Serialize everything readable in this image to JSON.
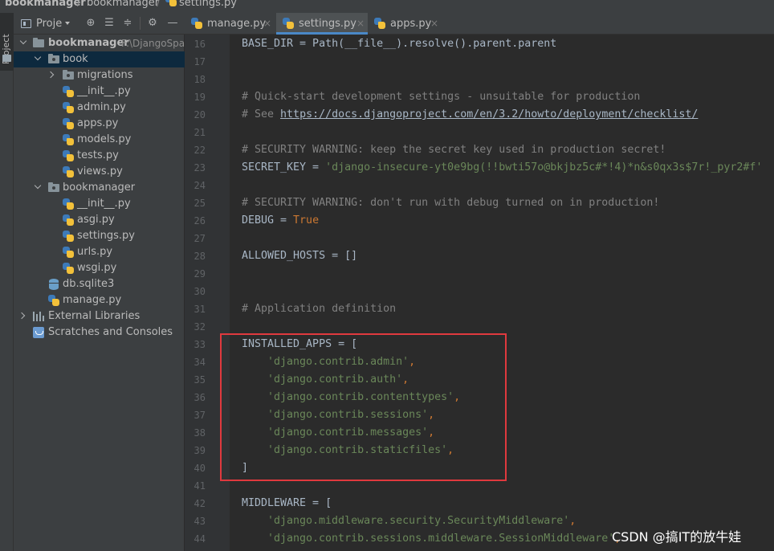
{
  "breadcrumb": {
    "items": [
      "bookmanager",
      "bookmanager",
      "settings.py"
    ],
    "separator": "/"
  },
  "tool_strip": {
    "project_label": "Project"
  },
  "project_panel": {
    "title": "Proje",
    "tree": [
      {
        "label": "bookmanager",
        "path": "F:\\DjangoSpa",
        "icon": "folder-icon",
        "expanded": true
      },
      {
        "label": "book",
        "icon": "folder-icon",
        "expanded": true,
        "selected": true
      },
      {
        "label": "migrations",
        "icon": "folder-icon",
        "expanded": false
      },
      {
        "label": "__init__.py",
        "icon": "python-file-icon"
      },
      {
        "label": "admin.py",
        "icon": "python-file-icon"
      },
      {
        "label": "apps.py",
        "icon": "python-file-icon"
      },
      {
        "label": "models.py",
        "icon": "python-file-icon"
      },
      {
        "label": "tests.py",
        "icon": "python-file-icon"
      },
      {
        "label": "views.py",
        "icon": "python-file-icon"
      },
      {
        "label": "bookmanager",
        "icon": "folder-icon",
        "expanded": true
      },
      {
        "label": "__init__.py",
        "icon": "python-file-icon"
      },
      {
        "label": "asgi.py",
        "icon": "python-file-icon"
      },
      {
        "label": "settings.py",
        "icon": "python-file-icon"
      },
      {
        "label": "urls.py",
        "icon": "python-file-icon"
      },
      {
        "label": "wsgi.py",
        "icon": "python-file-icon"
      },
      {
        "label": "db.sqlite3",
        "icon": "database-icon"
      },
      {
        "label": "manage.py",
        "icon": "python-file-icon"
      },
      {
        "label": "External Libraries",
        "icon": "library-icon",
        "expanded": false
      },
      {
        "label": "Scratches and Consoles",
        "icon": "scratch-icon"
      }
    ]
  },
  "tabs": [
    {
      "label": "manage.py",
      "active": false
    },
    {
      "label": "settings.py",
      "active": true
    },
    {
      "label": "apps.py",
      "active": false
    }
  ],
  "tab_close_glyph": "×",
  "line_numbers": [
    "16",
    "17",
    "18",
    "19",
    "20",
    "21",
    "22",
    "23",
    "24",
    "25",
    "26",
    "27",
    "28",
    "29",
    "30",
    "31",
    "32",
    "33",
    "34",
    "35",
    "36",
    "37",
    "38",
    "39",
    "40",
    "41",
    "42",
    "43",
    "44"
  ],
  "code": {
    "l16": "BASE_DIR = Path(__file__).resolve().parent.parent",
    "l19": "# Quick-start development settings - unsuitable for production",
    "l20_prefix": "# See ",
    "l20_url": "https://docs.djangoproject.com/en/3.2/howto/deployment/checklist/",
    "l22": "# SECURITY WARNING: keep the secret key used in production secret!",
    "l23_prefix": "SECRET_KEY = ",
    "l23_value": "'django-insecure-yt0e9bg(!!bwti57o@bkjbz5c#*!4)*n&s0qx3s$7r!_pyr2#f'",
    "l25": "# SECURITY WARNING: don't run with debug turned on in production!",
    "l26_prefix": "DEBUG = ",
    "l26_value": "True",
    "l28": "ALLOWED_HOSTS = []",
    "l31": "# Application definition",
    "l33": "INSTALLED_APPS = [",
    "apps": [
      "'django.contrib.admin'",
      "'django.contrib.auth'",
      "'django.contrib.contenttypes'",
      "'django.contrib.sessions'",
      "'django.contrib.messages'",
      "'django.contrib.staticfiles'"
    ],
    "l40": "]",
    "l42": "MIDDLEWARE = [",
    "middleware": [
      "'django.middleware.security.SecurityMiddleware'",
      "'django.contrib.sessions.middleware.SessionMiddleware'"
    ],
    "comma": ","
  },
  "watermark": "CSDN @搞IT的放牛娃",
  "colors": {
    "string": "#6a8759",
    "keyword": "#cc7832",
    "comment": "#808080",
    "highlight_box": "#e0393e"
  }
}
